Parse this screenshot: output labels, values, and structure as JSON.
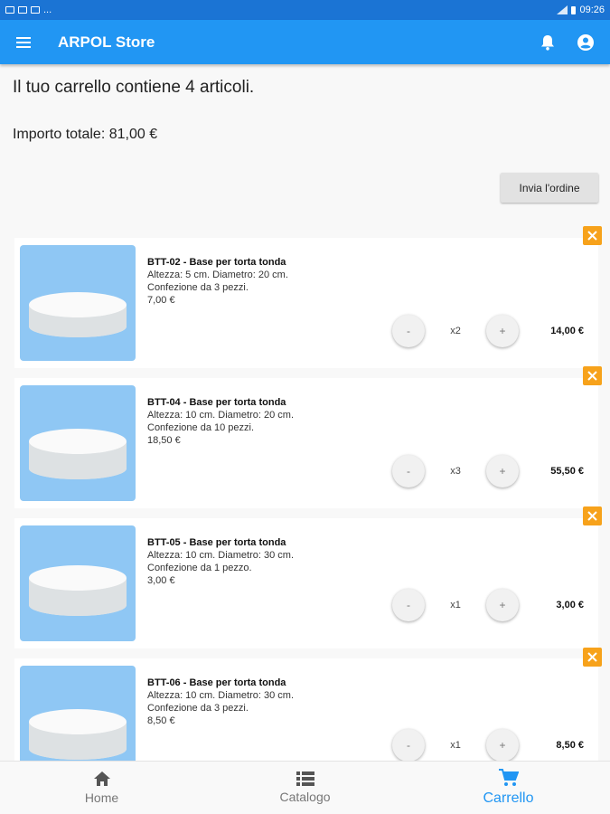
{
  "status_bar": {
    "time": "09:26",
    "more": "..."
  },
  "app_bar": {
    "title": "ARPOL Store"
  },
  "cart": {
    "summary": "Il tuo carrello contiene 4 articoli.",
    "total": "Importo totale: 81,00 €",
    "send_label": "Invia l'ordine",
    "items": [
      {
        "name": "BTT-02 - Base per torta tonda",
        "dims": "Altezza: 5 cm. Diametro: 20 cm.",
        "pack": "Confezione da 3 pezzi.",
        "price": "7,00 €",
        "qty": "x2",
        "subtotal": "14,00 €",
        "minus": "-",
        "plus": "+"
      },
      {
        "name": "BTT-04 - Base per torta tonda",
        "dims": "Altezza: 10 cm. Diametro: 20 cm.",
        "pack": "Confezione da 10 pezzi.",
        "price": "18,50 €",
        "qty": "x3",
        "subtotal": "55,50 €",
        "minus": "-",
        "plus": "+"
      },
      {
        "name": "BTT-05 - Base per torta tonda",
        "dims": "Altezza: 10 cm. Diametro: 30 cm.",
        "pack": "Confezione da 1 pezzo.",
        "price": "3,00 €",
        "qty": "x1",
        "subtotal": "3,00 €",
        "minus": "-",
        "plus": "+"
      },
      {
        "name": "BTT-06 - Base per torta tonda",
        "dims": "Altezza: 10 cm. Diametro: 30 cm.",
        "pack": "Confezione da 3 pezzi.",
        "price": "8,50 €",
        "qty": "x1",
        "subtotal": "8,50 €",
        "minus": "-",
        "plus": "+"
      }
    ]
  },
  "bottom_nav": {
    "items": [
      {
        "label": "Home",
        "icon": "home-icon"
      },
      {
        "label": "Catalogo",
        "icon": "list-icon"
      },
      {
        "label": "Carrello",
        "icon": "cart-icon",
        "active": true
      }
    ]
  },
  "colors": {
    "primary": "#2196f3",
    "status_bar": "#1b74d4",
    "remove": "#f7a21b",
    "thumb_bg": "#8fc7f4"
  }
}
